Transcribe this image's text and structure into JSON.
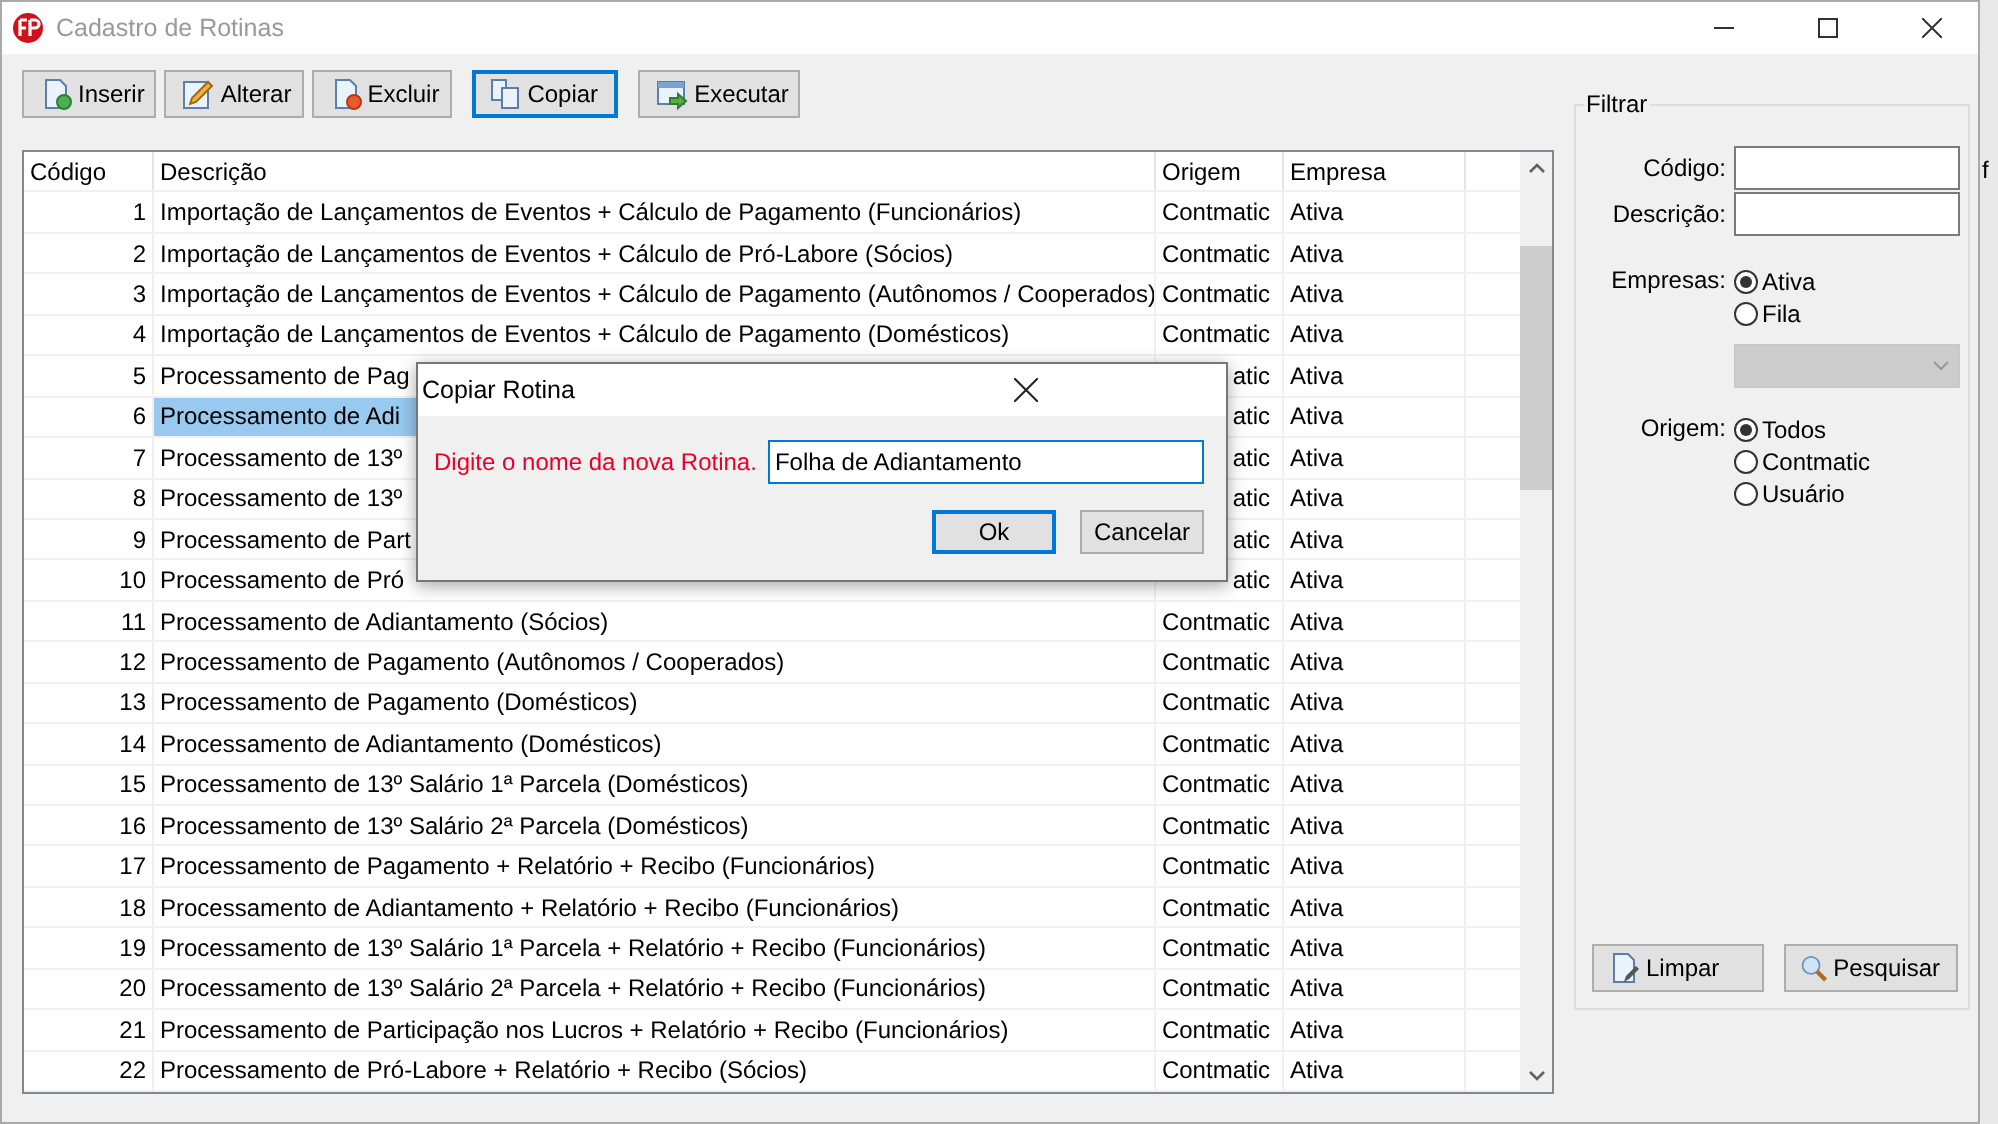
{
  "window": {
    "title": "Cadastro de Rotinas"
  },
  "toolbar": [
    {
      "label": "Inserir",
      "kind": "insert",
      "focused": false
    },
    {
      "label": "Alterar",
      "kind": "edit",
      "focused": false
    },
    {
      "label": "Excluir",
      "kind": "delete",
      "focused": false
    },
    {
      "label": "Copiar",
      "kind": "copy",
      "focused": true
    },
    {
      "label": "Executar",
      "kind": "run",
      "focused": false
    }
  ],
  "table": {
    "columns": [
      "Código",
      "Descrição",
      "Origem",
      "Empresa"
    ],
    "rows": [
      {
        "code": "1",
        "description": "Importação de Lançamentos de Eventos + Cálculo de Pagamento (Funcionários)",
        "origin": "Contmatic",
        "company": "Ativa",
        "selected": false
      },
      {
        "code": "2",
        "description": "Importação de Lançamentos de Eventos + Cálculo de Pró-Labore (Sócios)",
        "origin": "Contmatic",
        "company": "Ativa",
        "selected": false
      },
      {
        "code": "3",
        "description": "Importação de Lançamentos de Eventos + Cálculo de Pagamento (Autônomos / Cooperados)",
        "origin": "Contmatic",
        "company": "Ativa",
        "selected": false
      },
      {
        "code": "4",
        "description": "Importação de Lançamentos de Eventos + Cálculo de Pagamento (Domésticos)",
        "origin": "Contmatic",
        "company": "Ativa",
        "selected": false
      },
      {
        "code": "5",
        "description": "Processamento de Pag",
        "origin": "atic",
        "company": "Ativa",
        "selected": false
      },
      {
        "code": "6",
        "description": "Processamento de Adi",
        "origin": "atic",
        "company": "Ativa",
        "selected": true
      },
      {
        "code": "7",
        "description": "Processamento de 13º",
        "origin": "atic",
        "company": "Ativa",
        "selected": false
      },
      {
        "code": "8",
        "description": "Processamento de 13º",
        "origin": "atic",
        "company": "Ativa",
        "selected": false
      },
      {
        "code": "9",
        "description": "Processamento de Part",
        "origin": "atic",
        "company": "Ativa",
        "selected": false
      },
      {
        "code": "10",
        "description": "Processamento de Pró",
        "origin": "atic",
        "company": "Ativa",
        "selected": false
      },
      {
        "code": "11",
        "description": "Processamento de Adiantamento (Sócios)",
        "origin": "Contmatic",
        "company": "Ativa",
        "selected": false
      },
      {
        "code": "12",
        "description": "Processamento de Pagamento (Autônomos / Cooperados)",
        "origin": "Contmatic",
        "company": "Ativa",
        "selected": false
      },
      {
        "code": "13",
        "description": "Processamento de Pagamento (Domésticos)",
        "origin": "Contmatic",
        "company": "Ativa",
        "selected": false
      },
      {
        "code": "14",
        "description": "Processamento de Adiantamento (Domésticos)",
        "origin": "Contmatic",
        "company": "Ativa",
        "selected": false
      },
      {
        "code": "15",
        "description": "Processamento de 13º Salário 1ª Parcela (Domésticos)",
        "origin": "Contmatic",
        "company": "Ativa",
        "selected": false
      },
      {
        "code": "16",
        "description": "Processamento de 13º Salário 2ª Parcela (Domésticos)",
        "origin": "Contmatic",
        "company": "Ativa",
        "selected": false
      },
      {
        "code": "17",
        "description": "Processamento de Pagamento + Relatório + Recibo (Funcionários)",
        "origin": "Contmatic",
        "company": "Ativa",
        "selected": false
      },
      {
        "code": "18",
        "description": "Processamento de Adiantamento + Relatório + Recibo (Funcionários)",
        "origin": "Contmatic",
        "company": "Ativa",
        "selected": false
      },
      {
        "code": "19",
        "description": "Processamento de 13º Salário 1ª Parcela + Relatório + Recibo (Funcionários)",
        "origin": "Contmatic",
        "company": "Ativa",
        "selected": false
      },
      {
        "code": "20",
        "description": "Processamento de 13º Salário 2ª Parcela + Relatório + Recibo (Funcionários)",
        "origin": "Contmatic",
        "company": "Ativa",
        "selected": false
      },
      {
        "code": "21",
        "description": "Processamento de Participação nos Lucros + Relatório + Recibo (Funcionários)",
        "origin": "Contmatic",
        "company": "Ativa",
        "selected": false
      },
      {
        "code": "22",
        "description": "Processamento de Pró-Labore + Relatório + Recibo (Sócios)",
        "origin": "Contmatic",
        "company": "Ativa",
        "selected": false
      }
    ]
  },
  "filter": {
    "title": "Filtrar",
    "fields": [
      {
        "label": "Código:"
      },
      {
        "label": "Descrição:"
      }
    ],
    "companies": {
      "label": "Empresas:",
      "options": [
        {
          "label": "Ativa",
          "selected": true
        },
        {
          "label": "Fila",
          "selected": false
        }
      ]
    },
    "dropdown": {
      "disabled": true
    },
    "origin": {
      "label": "Origem:",
      "options": [
        {
          "label": "Todos",
          "selected": true
        },
        {
          "label": "Contmatic",
          "selected": false
        },
        {
          "label": "Usuário",
          "selected": false
        }
      ]
    },
    "buttons": [
      {
        "label": "Limpar",
        "kind": "clear"
      },
      {
        "label": "Pesquisar",
        "kind": "search"
      }
    ]
  },
  "dialog": {
    "title": "Copiar Rotina",
    "prompt": "Digite o nome da nova Rotina.",
    "value": "Folha de Adiantamento",
    "buttons": [
      {
        "label": "Ok",
        "default": true
      },
      {
        "label": "Cancelar",
        "default": false
      }
    ]
  },
  "background_text": "f"
}
